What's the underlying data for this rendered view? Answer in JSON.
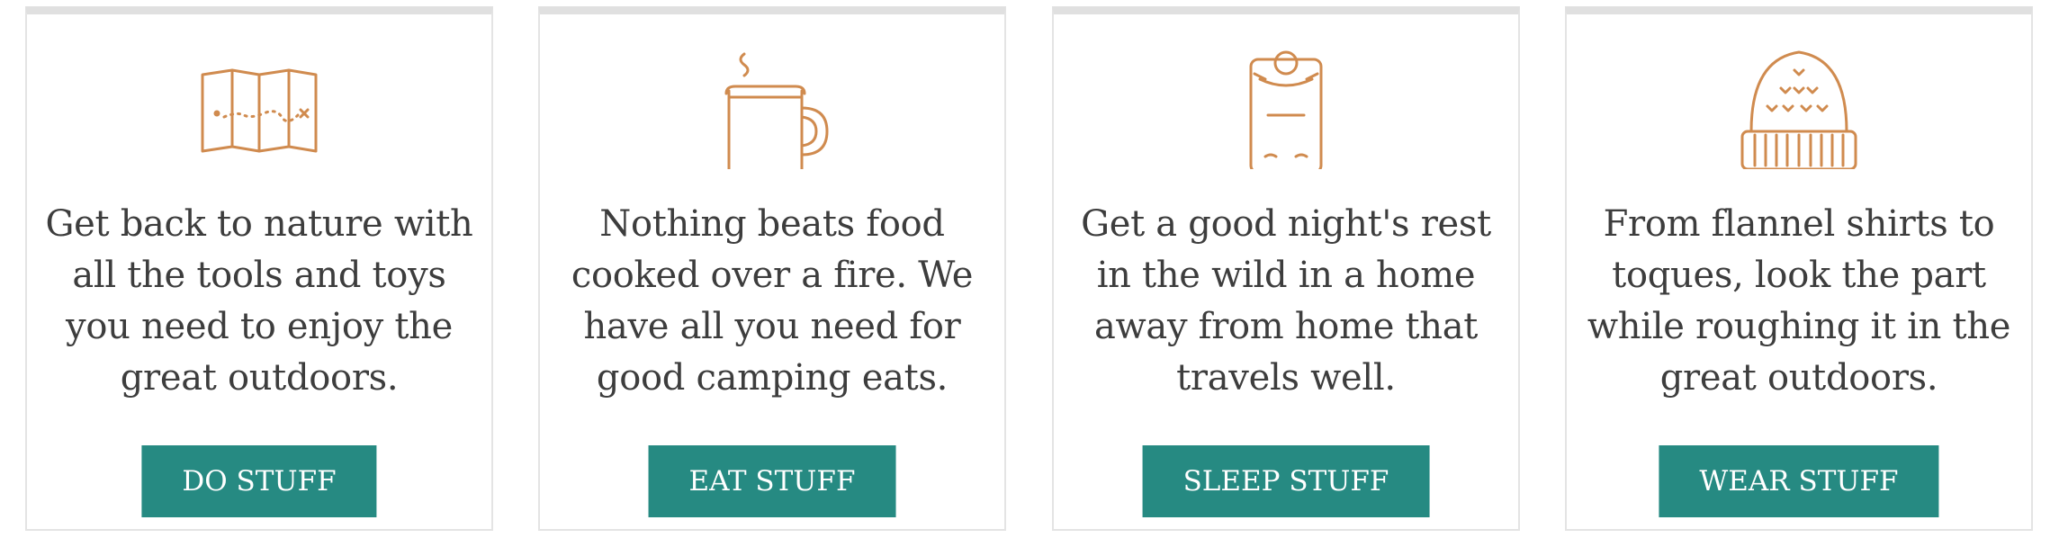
{
  "accent_color": "#268a82",
  "icon_color": "#d08b4f",
  "cards": [
    {
      "icon": "map-icon",
      "description": "Get back to nature with all the tools and toys you need to enjoy the great outdoors.",
      "button_label": "DO STUFF"
    },
    {
      "icon": "mug-icon",
      "description": "Nothing beats food cooked over a fire. We have all you need for good camping eats.",
      "button_label": "EAT STUFF"
    },
    {
      "icon": "sleeping-bag-icon",
      "description": "Get a good night's rest in the wild in a home away from home that travels well.",
      "button_label": "SLEEP STUFF"
    },
    {
      "icon": "toque-icon",
      "description": "From flannel shirts to toques, look the part while roughing it in the great outdoors.",
      "button_label": "WEAR STUFF"
    }
  ]
}
